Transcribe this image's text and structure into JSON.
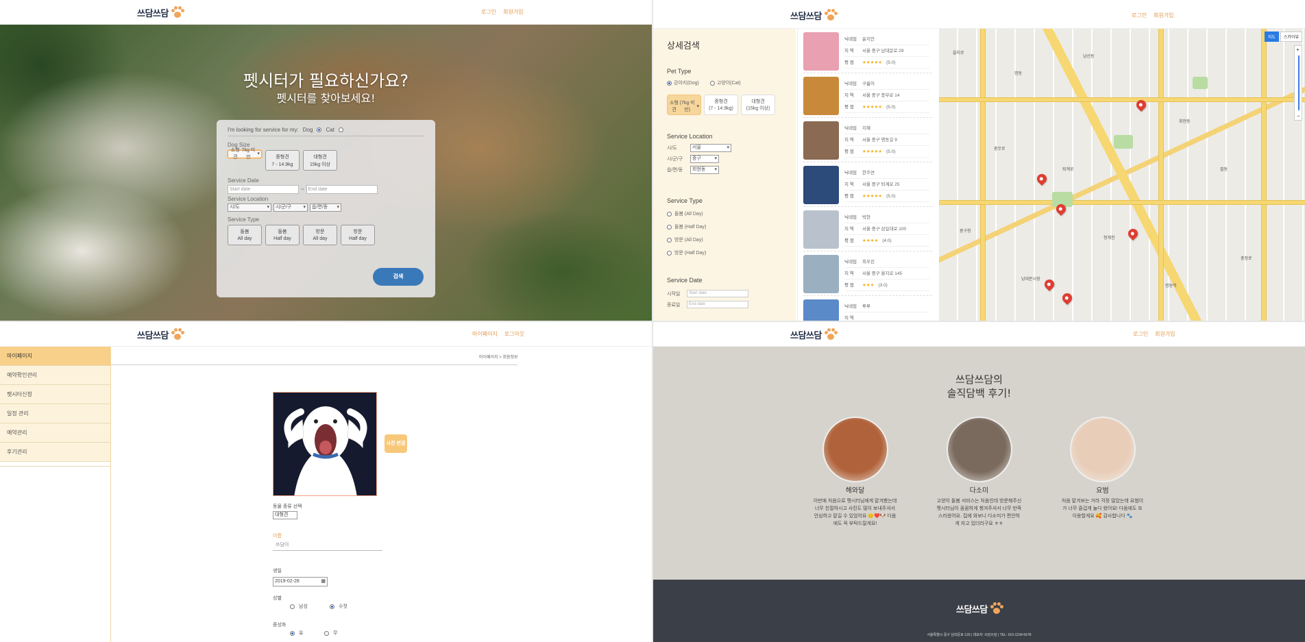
{
  "brand": {
    "logo_text": "쓰담쓰담"
  },
  "q1": {
    "nav": [
      "로그인",
      "회원가입"
    ],
    "hero_title": "펫시터가 필요하신가요?",
    "hero_sub": "펫시터를 찾아보세요!",
    "looking_label": "I'm looking for service for my:",
    "pet_dog": "Dog",
    "pet_cat": "Cat",
    "dog_size_label": "Dog Size",
    "sizes": [
      {
        "name": "소형견",
        "range": "7kg 미만"
      },
      {
        "name": "중형견",
        "range": "7 - 14.9kg"
      },
      {
        "name": "대형견",
        "range": "15kg 이상"
      }
    ],
    "service_date_label": "Service Date",
    "start_placeholder": "Start date",
    "date_sep": "~",
    "end_placeholder": "End date",
    "service_location_label": "Service Location",
    "loc_selects": [
      "시/도",
      "시/군/구",
      "읍/면/동"
    ],
    "service_type_label": "Service Type",
    "types": [
      {
        "name": "돌봄",
        "dur": "All day"
      },
      {
        "name": "돌봄",
        "dur": "Half day"
      },
      {
        "name": "방문",
        "dur": "All day"
      },
      {
        "name": "방문",
        "dur": "Half day"
      }
    ],
    "search_button": "검색"
  },
  "q2": {
    "nav": [
      "로그인",
      "회원가입"
    ],
    "title": "상세검색",
    "pet_type_label": "Pet Type",
    "pet_types": [
      "강아지(Dog)",
      "고양이(Cat)"
    ],
    "dog_sizes": [
      {
        "name": "소형견",
        "range": "(7kg 미만)"
      },
      {
        "name": "중형견",
        "range": "(7 - 14.9kg)"
      },
      {
        "name": "대형견",
        "range": "(15kg 이상)"
      }
    ],
    "service_location_label": "Service Location",
    "loc_rows": [
      {
        "label": "시/도",
        "value": "서울"
      },
      {
        "label": "시/군/구",
        "value": "중구"
      },
      {
        "label": "읍/면/동",
        "value": "회현동"
      }
    ],
    "service_type_label": "Service Type",
    "service_types": [
      "돌봄 (All Day)",
      "돌봄 (Half Day)",
      "방문 (All Day)",
      "방문 (Half Day)"
    ],
    "service_date_label": "Service Date",
    "date_rows": [
      {
        "label": "시작일",
        "placeholder": "Start date"
      },
      {
        "label": "종료일",
        "placeholder": "End date"
      }
    ],
    "field_labels": {
      "nick": "닉네임",
      "area": "지 역",
      "rating": "평 점"
    },
    "sitters": [
      {
        "nick": "윤지민",
        "area": "서울 중구 남대문로 29",
        "stars": "★★★★★",
        "score": "(5.0)",
        "color": "#e9a0b0"
      },
      {
        "nick": "구름이",
        "area": "서울 중구 충무로 14",
        "stars": "★★★★★",
        "score": "(5.0)",
        "color": "#c88a3a"
      },
      {
        "nick": "지혜",
        "area": "서울 중구 명동길 9",
        "stars": "★★★★★",
        "score": "(5.0)",
        "color": "#8a6a52"
      },
      {
        "nick": "한주연",
        "area": "서울 중구 퇴계로 25",
        "stars": "★★★★★",
        "score": "(5.0)",
        "color": "#2c4a7a"
      },
      {
        "nick": "박현",
        "area": "서울 중구 삼일대로 100",
        "stars": "★★★★",
        "score": "(4.0)",
        "color": "#b9c2cc"
      },
      {
        "nick": "최우진",
        "area": "서울 중구 을지로 145",
        "stars": "★★★",
        "score": "(3.0)",
        "color": "#9ab0c0"
      },
      {
        "nick": "루루",
        "area": "",
        "stars": "",
        "score": "",
        "color": "#5a8ac8"
      }
    ],
    "map_controls": [
      "지도",
      "스카이뷰"
    ],
    "map_labels": [
      "을지로",
      "명동",
      "남산동",
      "회현동",
      "충무로",
      "퇴계로",
      "필동",
      "중구청",
      "청계천",
      "남대문시장",
      "명동역",
      "충정로"
    ]
  },
  "q3": {
    "nav": [
      "마이페이지",
      "로그아웃"
    ],
    "menu": [
      "마이페이지",
      "예약확인관리",
      "펫시터신청",
      "일정 관리",
      "예약관리",
      "후기관리"
    ],
    "crumb": "마이페이지 > 회원정보",
    "photo_button": "사진 변경",
    "animal_label": "동물 종류 선택",
    "animal_value": "대형견",
    "name_label": "이름",
    "name_value": "쓰담이",
    "birth_label": "생일",
    "birth_value": "2019-02-28",
    "gender_label": "성별",
    "gender_options": [
      "남성",
      "수컷"
    ],
    "neuter_label": "중성화",
    "neuter_options": [
      "유",
      "무"
    ]
  },
  "q4": {
    "nav": [
      "로그인",
      "회원가입"
    ],
    "title_line1": "쓰담쓰담의",
    "title_line2": "솔직담백 후기!",
    "reviews": [
      {
        "name": "해와달",
        "text": "이번에 처음으로 펫시터님에게 맡겨봤는데 너무 친절하시고 사진도 많이 보내주셔서 안심하고 맡길 수 있었어요 😊❤️🐶 다음에도 꼭 부탁드릴게요!",
        "color": "#b0623a"
      },
      {
        "name": "다소미",
        "text": "고양이 돌봄 서비스는 처음인데 방문해주신 펫시터님이 꼼꼼하게 챙겨주셔서 너무 만족스러웠어요. 집에 와보니 다소미가 편안하게 자고 있더라구요 ㅎㅎ",
        "color": "#7a6a5e"
      },
      {
        "name": "요범",
        "text": "처음 맡겨보는 거라 걱정 많았는데 요범이가 너무 즐겁게 놀다 왔어요! 다음에도 또 이용할게요 🥰 감사합니다 🐾",
        "color": "#e8cdb8"
      }
    ],
    "footer_text": "서울특별시 중구 남대문로 120 | 대표자: 쓰담쓰담 | TEL: 010-1234-5678"
  }
}
